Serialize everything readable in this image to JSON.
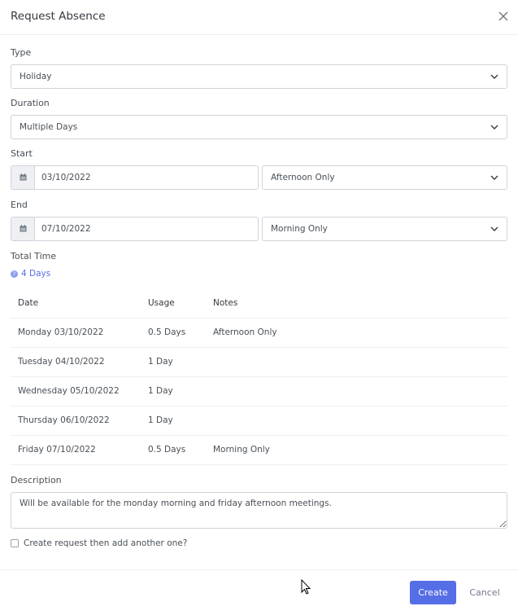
{
  "dialog": {
    "title": "Request Absence"
  },
  "form": {
    "type": {
      "label": "Type",
      "value": "Holiday"
    },
    "duration": {
      "label": "Duration",
      "value": "Multiple Days"
    },
    "start": {
      "label": "Start",
      "date": "03/10/2022",
      "part": "Afternoon Only"
    },
    "end": {
      "label": "End",
      "date": "07/10/2022",
      "part": "Morning Only"
    },
    "total_time": {
      "label": "Total Time",
      "value": "4 Days",
      "help_icon": "?"
    }
  },
  "table": {
    "headers": [
      "Date",
      "Usage",
      "Notes"
    ],
    "rows": [
      {
        "date": "Monday 03/10/2022",
        "usage": "0.5 Days",
        "notes": "Afternoon Only"
      },
      {
        "date": "Tuesday 04/10/2022",
        "usage": "1 Day",
        "notes": ""
      },
      {
        "date": "Wednesday 05/10/2022",
        "usage": "1 Day",
        "notes": ""
      },
      {
        "date": "Thursday 06/10/2022",
        "usage": "1 Day",
        "notes": ""
      },
      {
        "date": "Friday 07/10/2022",
        "usage": "0.5 Days",
        "notes": "Morning Only"
      }
    ]
  },
  "description": {
    "label": "Description",
    "value": "Will be available for the monday morning and friday afternoon meetings."
  },
  "checkbox": {
    "label": "Create request then add another one?",
    "checked": false
  },
  "footer": {
    "create_label": "Create",
    "cancel_label": "Cancel"
  },
  "colors": {
    "accent": "#556ee6",
    "border": "#ced4da"
  }
}
